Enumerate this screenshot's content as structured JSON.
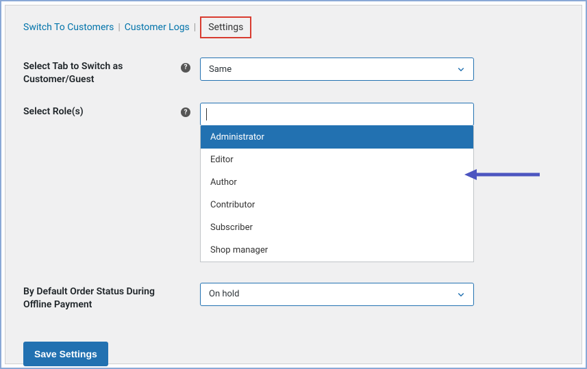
{
  "tabs": {
    "items": [
      {
        "label": "Switch To Customers"
      },
      {
        "label": "Customer Logs"
      }
    ],
    "active": "Settings"
  },
  "fields": {
    "tab_switch": {
      "label": "Select Tab to Switch as Customer/Guest",
      "value": "Same"
    },
    "roles": {
      "label": "Select Role(s)",
      "options": [
        "Administrator",
        "Editor",
        "Author",
        "Contributor",
        "Subscriber",
        "Shop manager"
      ]
    },
    "order_status": {
      "label": "By Default Order Status During Offline Payment",
      "value": "On hold"
    }
  },
  "buttons": {
    "save": "Save Settings"
  },
  "help_glyph": "?"
}
